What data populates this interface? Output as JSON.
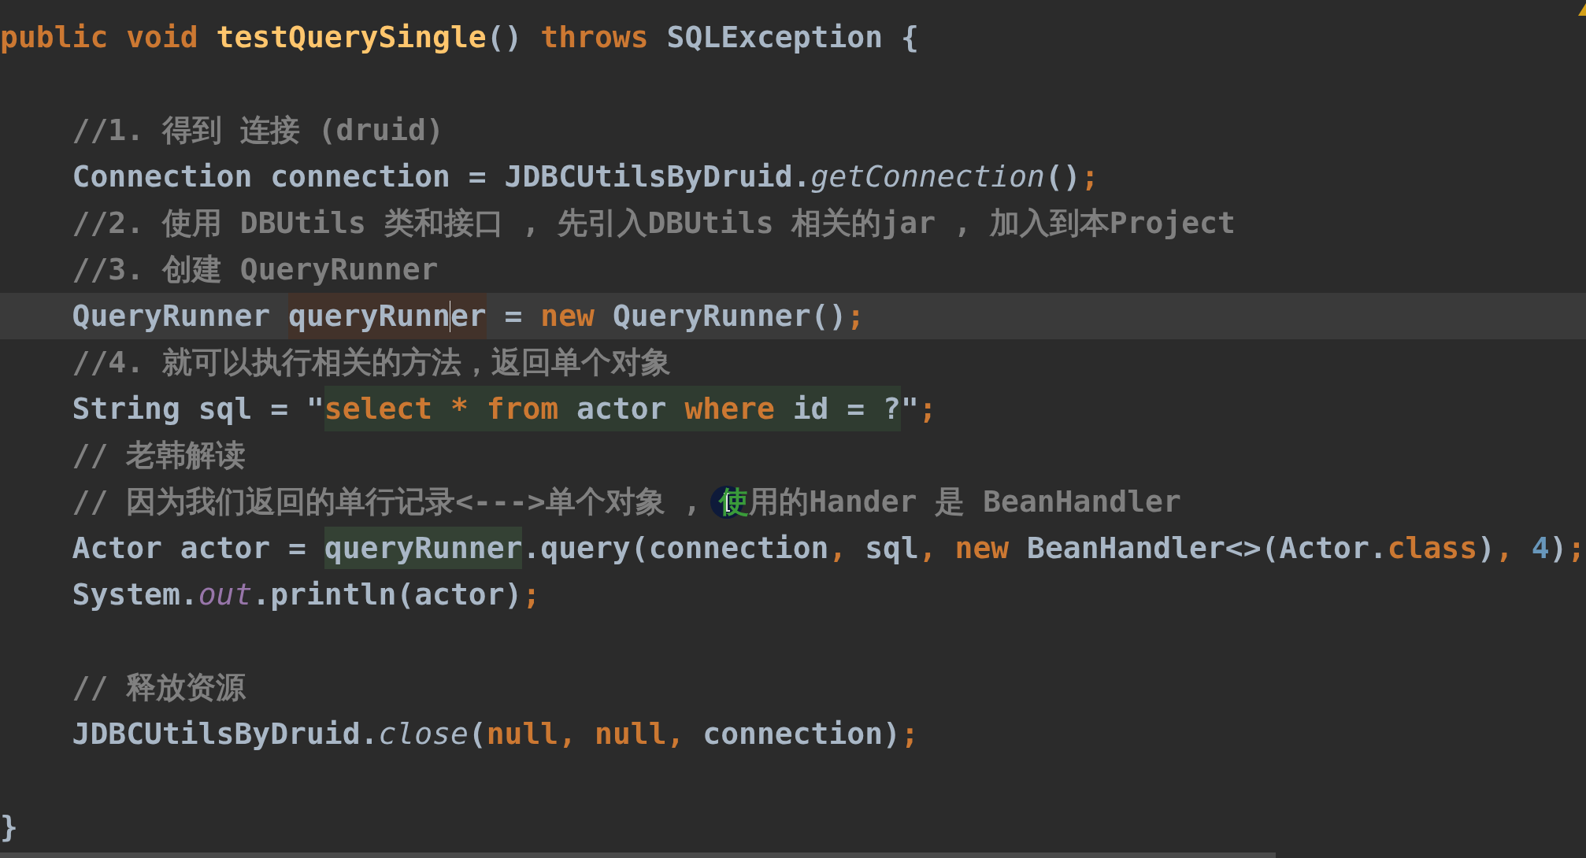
{
  "editor": {
    "lines": [
      {
        "kind": "code",
        "current": false,
        "tokens": [
          {
            "text": "public ",
            "kind": "keyword"
          },
          {
            "text": "void ",
            "kind": "keyword"
          },
          {
            "text": "testQuerySingle",
            "kind": "declaration"
          },
          {
            "text": "() ",
            "kind": "plain"
          },
          {
            "text": "throws",
            "kind": "keyword"
          },
          {
            "text": " SQLException {",
            "kind": "plain"
          }
        ]
      },
      {
        "kind": "blank"
      },
      {
        "kind": "code",
        "current": false,
        "tokens": [
          {
            "text": "    //1. 得到 连接 (druid)",
            "kind": "comment"
          }
        ]
      },
      {
        "kind": "code",
        "current": false,
        "tokens": [
          {
            "text": "    Connection connection = JDBCUtilsByDruid.",
            "kind": "plain"
          },
          {
            "text": "getConnection",
            "kind": "static-call"
          },
          {
            "text": "()",
            "kind": "plain"
          },
          {
            "text": ";",
            "kind": "punct"
          }
        ]
      },
      {
        "kind": "code",
        "current": false,
        "tokens": [
          {
            "text": "    //2. 使用 DBUtils 类和接口 , 先引入DBUtils 相关的jar , 加入到本Project",
            "kind": "comment"
          }
        ]
      },
      {
        "kind": "code",
        "current": false,
        "tokens": [
          {
            "text": "    //3. 创建 QueryRunner",
            "kind": "comment"
          }
        ]
      },
      {
        "kind": "code",
        "current": true,
        "tokens": [
          {
            "text": "    QueryRunner ",
            "kind": "plain"
          },
          {
            "text": "queryRunn",
            "kind": "plain",
            "usage_highlight": true,
            "caret_after": true
          },
          {
            "text": "er",
            "kind": "plain",
            "usage_highlight": true
          },
          {
            "text": " = ",
            "kind": "plain"
          },
          {
            "text": "new",
            "kind": "keyword"
          },
          {
            "text": " QueryRunner()",
            "kind": "plain"
          },
          {
            "text": ";",
            "kind": "punct"
          }
        ]
      },
      {
        "kind": "code",
        "current": false,
        "tokens": [
          {
            "text": "    //4. 就可以执行相关的方法，返回单个对象",
            "kind": "comment"
          }
        ]
      },
      {
        "kind": "code",
        "current": false,
        "tokens": [
          {
            "text": "    String sql = \"",
            "kind": "plain"
          },
          {
            "text": "select *",
            "kind": "keyword",
            "sql_highlight": true
          },
          {
            "text": " from",
            "kind": "keyword",
            "sql_highlight": true
          },
          {
            "text": " actor ",
            "kind": "plain",
            "sql_highlight": true
          },
          {
            "text": "where",
            "kind": "keyword",
            "sql_highlight": true
          },
          {
            "text": " id = ?",
            "kind": "plain",
            "sql_highlight": true
          },
          {
            "text": "\"",
            "kind": "plain"
          },
          {
            "text": ";",
            "kind": "punct"
          }
        ]
      },
      {
        "kind": "code",
        "current": false,
        "tokens": [
          {
            "text": "    // 老韩解读",
            "kind": "comment"
          }
        ]
      },
      {
        "kind": "code",
        "current": false,
        "tokens": [
          {
            "text": "    // 因为我们返回的单行记录<--->单个对象 , ",
            "kind": "comment"
          },
          {
            "text": "使",
            "kind": "comment",
            "pointer": true
          },
          {
            "text": "用的Hander 是 BeanHandler",
            "kind": "comment"
          }
        ]
      },
      {
        "kind": "code",
        "current": false,
        "tokens": [
          {
            "text": "    Actor actor = ",
            "kind": "plain"
          },
          {
            "text": "queryRunner",
            "kind": "plain",
            "match_highlight": true
          },
          {
            "text": ".query(connection",
            "kind": "plain"
          },
          {
            "text": ",",
            "kind": "punct"
          },
          {
            "text": " sql",
            "kind": "plain"
          },
          {
            "text": ", ",
            "kind": "punct"
          },
          {
            "text": "new",
            "kind": "keyword"
          },
          {
            "text": " BeanHandler<>(Actor.",
            "kind": "plain"
          },
          {
            "text": "class",
            "kind": "keyword"
          },
          {
            "text": ")",
            "kind": "plain"
          },
          {
            "text": ", ",
            "kind": "punct"
          },
          {
            "text": "4",
            "kind": "number"
          },
          {
            "text": ")",
            "kind": "plain"
          },
          {
            "text": ";",
            "kind": "punct"
          }
        ]
      },
      {
        "kind": "code",
        "current": false,
        "tokens": [
          {
            "text": "    System.",
            "kind": "plain"
          },
          {
            "text": "out",
            "kind": "static-field"
          },
          {
            "text": ".println(actor)",
            "kind": "plain"
          },
          {
            "text": ";",
            "kind": "punct"
          }
        ]
      },
      {
        "kind": "blank"
      },
      {
        "kind": "code",
        "current": false,
        "tokens": [
          {
            "text": "    // 释放资源",
            "kind": "comment"
          }
        ]
      },
      {
        "kind": "code",
        "current": false,
        "tokens": [
          {
            "text": "    JDBCUtilsByDruid.",
            "kind": "plain"
          },
          {
            "text": "close",
            "kind": "static-call"
          },
          {
            "text": "(",
            "kind": "plain"
          },
          {
            "text": "null",
            "kind": "keyword"
          },
          {
            "text": ", ",
            "kind": "punct"
          },
          {
            "text": "null",
            "kind": "keyword"
          },
          {
            "text": ",",
            "kind": "punct"
          },
          {
            "text": " connection)",
            "kind": "plain"
          },
          {
            "text": ";",
            "kind": "punct"
          }
        ]
      },
      {
        "kind": "blank"
      },
      {
        "kind": "code",
        "current": false,
        "tokens": [
          {
            "text": "}",
            "kind": "plain"
          }
        ]
      }
    ]
  }
}
